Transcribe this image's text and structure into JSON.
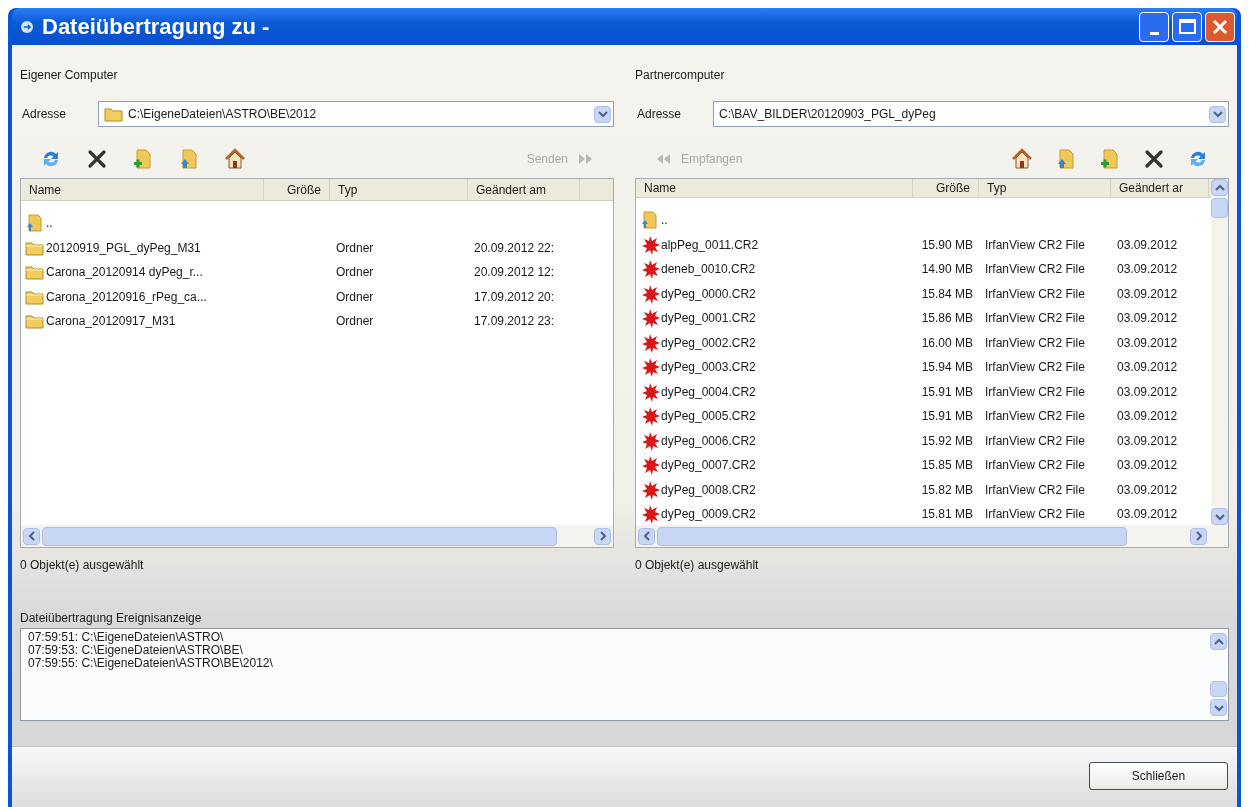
{
  "window": {
    "title": "Dateiübertragung zu -"
  },
  "panels": [
    {
      "kind": "local",
      "heading": "Eigener Computer",
      "address_label": "Adresse",
      "address": "C:\\EigeneDateien\\ASTRO\\BE\\2012",
      "transfer": {
        "label": "Senden",
        "disabled": true
      },
      "columns": [
        "Name",
        "Größe",
        "Typ",
        "Geändert am"
      ],
      "rows": [
        {
          "kind": "parent",
          "name": ".."
        },
        {
          "kind": "folder",
          "name": "20120919_PGL_dyPeg_M31",
          "type": "Ordner",
          "modified": "20.09.2012 22:"
        },
        {
          "kind": "folder",
          "name": "Carona_20120914 dyPeg_r...",
          "type": "Ordner",
          "modified": "20.09.2012 12:"
        },
        {
          "kind": "folder",
          "name": "Carona_20120916_rPeg_ca...",
          "type": "Ordner",
          "modified": "17.09.2012 20:"
        },
        {
          "kind": "folder",
          "name": "Carona_20120917_M31",
          "type": "Ordner",
          "modified": "17.09.2012 23:"
        }
      ],
      "status": "0 Objekt(e) ausgewählt"
    },
    {
      "kind": "remote",
      "heading": "Partnercomputer",
      "address_label": "Adresse",
      "address": "C:\\BAV_BILDER\\20120903_PGL_dyPeg",
      "transfer": {
        "label": "Empfangen",
        "disabled": true
      },
      "columns": [
        "Name",
        "Größe",
        "Typ",
        "Geändert ar"
      ],
      "rows": [
        {
          "kind": "parent",
          "name": ".."
        },
        {
          "kind": "file",
          "name": "alpPeg_0011.CR2",
          "size": "15.90 MB",
          "type": "IrfanView CR2 File",
          "modified": "03.09.2012"
        },
        {
          "kind": "file",
          "name": "deneb_0010.CR2",
          "size": "14.90 MB",
          "type": "IrfanView CR2 File",
          "modified": "03.09.2012"
        },
        {
          "kind": "file",
          "name": "dyPeg_0000.CR2",
          "size": "15.84 MB",
          "type": "IrfanView CR2 File",
          "modified": "03.09.2012"
        },
        {
          "kind": "file",
          "name": "dyPeg_0001.CR2",
          "size": "15.86 MB",
          "type": "IrfanView CR2 File",
          "modified": "03.09.2012"
        },
        {
          "kind": "file",
          "name": "dyPeg_0002.CR2",
          "size": "16.00 MB",
          "type": "IrfanView CR2 File",
          "modified": "03.09.2012"
        },
        {
          "kind": "file",
          "name": "dyPeg_0003.CR2",
          "size": "15.94 MB",
          "type": "IrfanView CR2 File",
          "modified": "03.09.2012"
        },
        {
          "kind": "file",
          "name": "dyPeg_0004.CR2",
          "size": "15.91 MB",
          "type": "IrfanView CR2 File",
          "modified": "03.09.2012"
        },
        {
          "kind": "file",
          "name": "dyPeg_0005.CR2",
          "size": "15.91 MB",
          "type": "IrfanView CR2 File",
          "modified": "03.09.2012"
        },
        {
          "kind": "file",
          "name": "dyPeg_0006.CR2",
          "size": "15.92 MB",
          "type": "IrfanView CR2 File",
          "modified": "03.09.2012"
        },
        {
          "kind": "file",
          "name": "dyPeg_0007.CR2",
          "size": "15.85 MB",
          "type": "IrfanView CR2 File",
          "modified": "03.09.2012"
        },
        {
          "kind": "file",
          "name": "dyPeg_0008.CR2",
          "size": "15.82 MB",
          "type": "IrfanView CR2 File",
          "modified": "03.09.2012"
        },
        {
          "kind": "file",
          "name": "dyPeg_0009.CR2",
          "size": "15.81 MB",
          "type": "IrfanView CR2 File",
          "modified": "03.09.2012"
        }
      ],
      "status": "0 Objekt(e) ausgewählt"
    }
  ],
  "log": {
    "label": "Dateiübertragung Ereignisanzeige",
    "lines": [
      "07:59:51: C:\\EigeneDateien\\ASTRO\\",
      "07:59:53: C:\\EigeneDateien\\ASTRO\\BE\\",
      "07:59:55: C:\\EigeneDateien\\ASTRO\\BE\\2012\\"
    ]
  },
  "buttons": [
    {
      "label": "Schließen"
    }
  ]
}
